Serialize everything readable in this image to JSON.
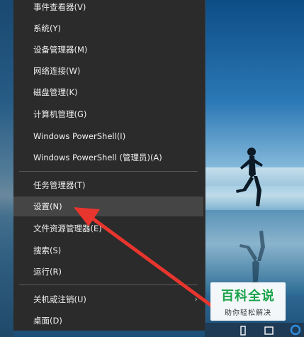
{
  "menu": {
    "items": [
      {
        "label": "事件查看器(V)"
      },
      {
        "label": "系统(Y)"
      },
      {
        "label": "设备管理器(M)"
      },
      {
        "label": "网络连接(W)"
      },
      {
        "label": "磁盘管理(K)"
      },
      {
        "label": "计算机管理(G)"
      },
      {
        "label": "Windows PowerShell(I)"
      },
      {
        "label": "Windows PowerShell (管理员)(A)"
      },
      {
        "label": "任务管理器(T)"
      },
      {
        "label": "设置(N)"
      },
      {
        "label": "文件资源管理器(E)"
      },
      {
        "label": "搜索(S)"
      },
      {
        "label": "运行(R)"
      },
      {
        "label": "关机或注销(U)"
      },
      {
        "label": "桌面(D)"
      }
    ],
    "highlighted": "设置(N)",
    "submenu_arrow": "›"
  },
  "watermark": {
    "title": "百科全说",
    "subtitle": "助你轻松解决"
  },
  "colors": {
    "menu_bg": "#2b2b2b",
    "menu_hover": "#454545",
    "menu_text": "#f0f0f0",
    "arrow": "#e8352e",
    "watermark_green": "#1aa34a"
  },
  "icons": [
    "runner-silhouette",
    "chevron-right-icon",
    "red-arrow-annotation",
    "taskbar-icon"
  ]
}
